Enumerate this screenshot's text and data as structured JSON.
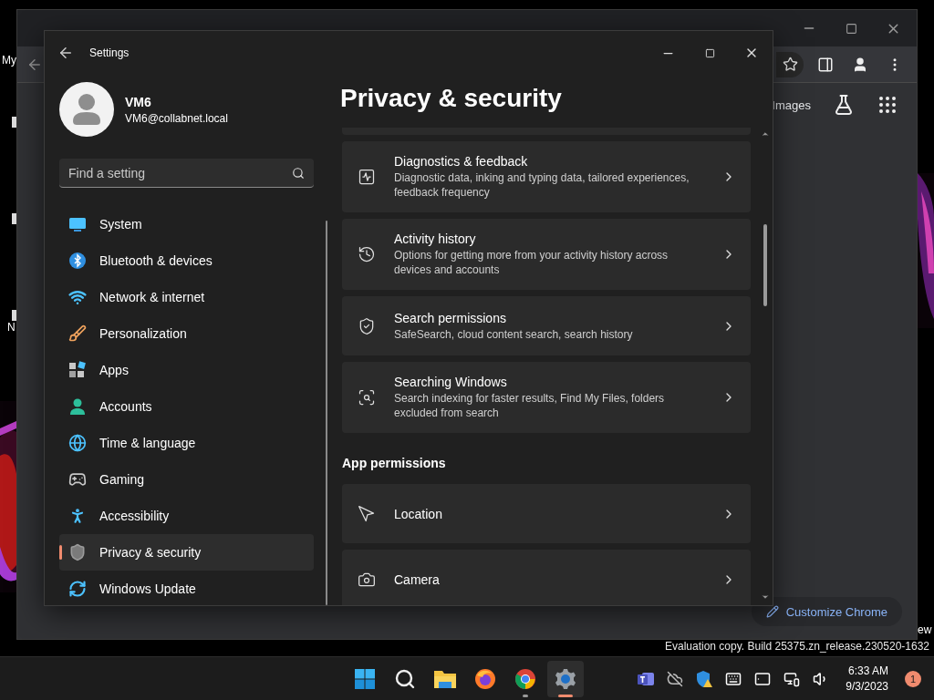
{
  "desktop": {
    "icon_labels": [
      "My",
      "N",
      "ew"
    ],
    "build_text": "Evaluation copy. Build 25375.zn_release.230520-1632"
  },
  "browser": {
    "images_link": "Images",
    "customize_button": "Customize Chrome"
  },
  "settings": {
    "title": "Settings",
    "user": {
      "name": "VM6",
      "email": "VM6@collabnet.local"
    },
    "search": {
      "placeholder": "Find a setting"
    },
    "nav": [
      {
        "label": "System",
        "kind": "system",
        "selected": false
      },
      {
        "label": "Bluetooth & devices",
        "kind": "bluetooth",
        "selected": false
      },
      {
        "label": "Network & internet",
        "kind": "network",
        "selected": false
      },
      {
        "label": "Personalization",
        "kind": "personalization",
        "selected": false
      },
      {
        "label": "Apps",
        "kind": "apps",
        "selected": false
      },
      {
        "label": "Accounts",
        "kind": "accounts",
        "selected": false
      },
      {
        "label": "Time & language",
        "kind": "time",
        "selected": false
      },
      {
        "label": "Gaming",
        "kind": "gaming",
        "selected": false
      },
      {
        "label": "Accessibility",
        "kind": "accessibility",
        "selected": false
      },
      {
        "label": "Privacy & security",
        "kind": "privacy",
        "selected": true
      },
      {
        "label": "Windows Update",
        "kind": "update",
        "selected": false
      }
    ],
    "page_title": "Privacy & security",
    "items": [
      {
        "title": "Diagnostics & feedback",
        "description": "Diagnostic data, inking and typing data, tailored experiences, feedback frequency",
        "kind": "diagnostics"
      },
      {
        "title": "Activity history",
        "description": "Options for getting more from your activity history across devices and accounts",
        "kind": "history"
      },
      {
        "title": "Search permissions",
        "description": "SafeSearch, cloud content search, search history",
        "kind": "search_permissions"
      },
      {
        "title": "Searching Windows",
        "description": "Search indexing for faster results, Find My Files, folders excluded from search",
        "kind": "searching"
      }
    ],
    "section_heading": "App permissions",
    "permissions": [
      {
        "title": "Location",
        "kind": "location"
      },
      {
        "title": "Camera",
        "kind": "camera"
      }
    ]
  },
  "taskbar": {
    "apps": [
      {
        "kind": "start",
        "running": false,
        "selected": false
      },
      {
        "kind": "search",
        "running": false,
        "selected": false
      },
      {
        "kind": "explorer",
        "running": false,
        "selected": false
      },
      {
        "kind": "firefox",
        "running": false,
        "selected": false
      },
      {
        "kind": "chrome",
        "running": true,
        "selected": false
      },
      {
        "kind": "settings",
        "running": true,
        "selected": true
      }
    ],
    "clock": {
      "time": "6:33 AM",
      "date": "9/3/2023"
    },
    "notification_count": "1"
  }
}
